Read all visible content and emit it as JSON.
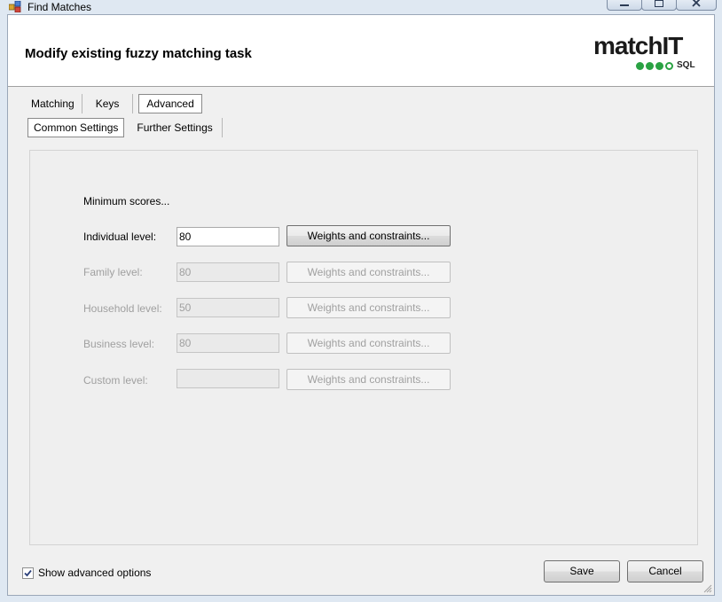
{
  "window": {
    "title": "Find Matches"
  },
  "header": {
    "title": "Modify existing fuzzy matching task",
    "logo_text_a": "match",
    "logo_text_b": "IT",
    "logo_sub": "SQL"
  },
  "tabs_main": [
    "Matching",
    "Keys",
    "Advanced"
  ],
  "tabs_main_active": "Advanced",
  "tabs_sub": [
    "Common Settings",
    "Further Settings"
  ],
  "tabs_sub_active": "Common Settings",
  "section_label": "Minimum scores...",
  "levels": [
    {
      "label": "Individual level:",
      "value": "80",
      "enabled": true,
      "button": "Weights and constraints..."
    },
    {
      "label": "Family level:",
      "value": "80",
      "enabled": false,
      "button": "Weights and constraints..."
    },
    {
      "label": "Household level:",
      "value": "50",
      "enabled": false,
      "button": "Weights and constraints..."
    },
    {
      "label": "Business level:",
      "value": "80",
      "enabled": false,
      "button": "Weights and constraints..."
    },
    {
      "label": "Custom level:",
      "value": "",
      "enabled": false,
      "button": "Weights and constraints..."
    }
  ],
  "footer": {
    "show_advanced_label": "Show advanced options",
    "show_advanced_checked": true,
    "save_label": "Save",
    "cancel_label": "Cancel"
  },
  "colors": {
    "logo_green": "#2aa243",
    "disabled_text": "#a0a0a0"
  }
}
